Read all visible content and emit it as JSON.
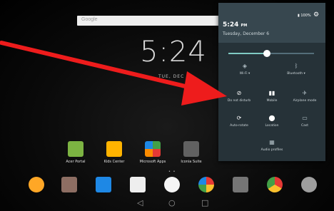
{
  "home": {
    "search_placeholder": "Google",
    "clock": "5:24",
    "date": "TUE, DEC 6",
    "apps": [
      {
        "label": "Acer Portal",
        "icon": "acer-portal-icon",
        "color": "#7cb342"
      },
      {
        "label": "Kids Center",
        "icon": "kids-center-icon",
        "color": "#ffb300"
      },
      {
        "label": "Microsoft Apps",
        "icon": "microsoft-apps-icon",
        "color": "#e53935"
      },
      {
        "label": "Iconia Suite",
        "icon": "iconia-suite-icon",
        "color": "#616161"
      }
    ],
    "page_indicator": "• •",
    "dock": [
      {
        "icon": "chat-icon",
        "color": "#ffa726"
      },
      {
        "icon": "contacts-icon",
        "color": "#8d6e63"
      },
      {
        "icon": "calendar-icon",
        "color": "#1e88e5"
      },
      {
        "icon": "gmail-icon",
        "color": "#eeeeee"
      },
      {
        "icon": "app-drawer-icon",
        "color": "#f5f5f5"
      },
      {
        "icon": "photos-icon",
        "color": "#fbc02d"
      },
      {
        "icon": "camera-icon",
        "color": "#757575"
      },
      {
        "icon": "chrome-icon",
        "color": "#43a047"
      },
      {
        "icon": "settings-icon",
        "color": "#9e9e9e"
      }
    ],
    "nav": {
      "back": "◁",
      "home": "○",
      "recents": "□"
    }
  },
  "shade": {
    "battery": "▮ 100%",
    "time": "5:24",
    "time_suffix": "PM",
    "date": "Tuesday, December 6",
    "brightness": 0.45,
    "tiles": [
      {
        "label": "Wi-Fi ▾",
        "icon": "wifi-icon",
        "glyph": "◈",
        "active": false
      },
      {
        "label": "Bluetooth ▾",
        "icon": "bluetooth-icon",
        "glyph": "ᛒ",
        "active": false
      },
      {
        "label": "Do not disturb",
        "icon": "do-not-disturb-icon",
        "glyph": "⊘",
        "active": true
      },
      {
        "label": "Mobile",
        "icon": "mobile-data-icon",
        "glyph": "▮▮",
        "active": true
      },
      {
        "label": "Airplane mode",
        "icon": "airplane-icon",
        "glyph": "✈",
        "active": false
      },
      {
        "label": "Auto-rotate",
        "icon": "auto-rotate-icon",
        "glyph": "⟳",
        "active": true
      },
      {
        "label": "Location",
        "icon": "location-icon",
        "glyph": "⬤",
        "active": true
      },
      {
        "label": "Cast",
        "icon": "cast-icon",
        "glyph": "▭",
        "active": false
      },
      {
        "label": "Audio profiles",
        "icon": "audio-profiles-icon",
        "glyph": "▦",
        "active": false
      }
    ]
  },
  "colors": {
    "arrow": "#ee1c1c",
    "shade_bg": "#263238",
    "shade_header": "#37474f",
    "accent": "#80cbc4"
  }
}
